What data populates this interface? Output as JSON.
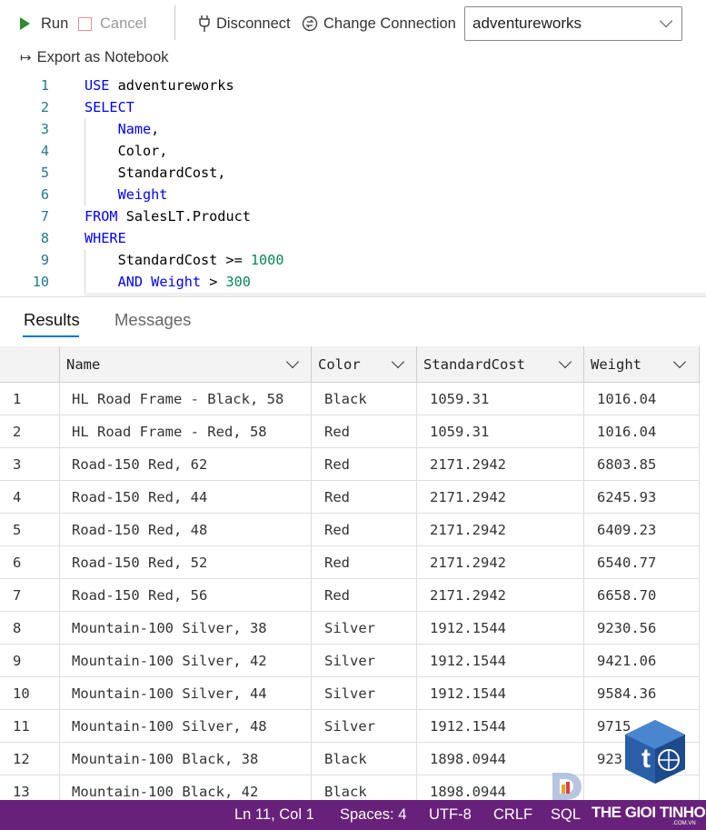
{
  "toolbar": {
    "run_label": "Run",
    "cancel_label": "Cancel",
    "disconnect_label": "Disconnect",
    "change_connection_label": "Change Connection",
    "database": "adventureworks",
    "export_label": "Export as Notebook"
  },
  "editor": {
    "lines": [
      {
        "n": "1",
        "indent": "",
        "parts": [
          {
            "t": "USE",
            "c": "kw"
          },
          {
            "t": " adventureworks",
            "c": "plain"
          }
        ]
      },
      {
        "n": "2",
        "indent": "",
        "parts": [
          {
            "t": "SELECT",
            "c": "kw"
          }
        ]
      },
      {
        "n": "3",
        "indent": "    ",
        "parts": [
          {
            "t": "Name",
            "c": "kw"
          },
          {
            "t": ",",
            "c": "plain"
          }
        ]
      },
      {
        "n": "4",
        "indent": "    ",
        "parts": [
          {
            "t": "Color,",
            "c": "plain"
          }
        ]
      },
      {
        "n": "5",
        "indent": "    ",
        "parts": [
          {
            "t": "StandardCost,",
            "c": "plain"
          }
        ]
      },
      {
        "n": "6",
        "indent": "    ",
        "parts": [
          {
            "t": "Weight",
            "c": "kw"
          }
        ]
      },
      {
        "n": "7",
        "indent": "",
        "parts": [
          {
            "t": "FROM",
            "c": "kw"
          },
          {
            "t": " SalesLT.Product",
            "c": "plain"
          }
        ]
      },
      {
        "n": "8",
        "indent": "",
        "parts": [
          {
            "t": "WHERE",
            "c": "kw"
          }
        ]
      },
      {
        "n": "9",
        "indent": "    ",
        "parts": [
          {
            "t": "StandardCost >= ",
            "c": "plain"
          },
          {
            "t": "1000",
            "c": "num"
          }
        ]
      },
      {
        "n": "10",
        "indent": "    ",
        "parts": [
          {
            "t": "AND",
            "c": "kw"
          },
          {
            "t": " ",
            "c": "plain"
          },
          {
            "t": "Weight",
            "c": "kw"
          },
          {
            "t": " > ",
            "c": "plain"
          },
          {
            "t": "300",
            "c": "num"
          }
        ]
      }
    ]
  },
  "results": {
    "tab_results": "Results",
    "tab_messages": "Messages",
    "columns": [
      "Name",
      "Color",
      "StandardCost",
      "Weight"
    ],
    "rows": [
      [
        "1",
        "HL Road Frame - Black, 58",
        "Black",
        "1059.31",
        "1016.04"
      ],
      [
        "2",
        "HL Road Frame - Red, 58",
        "Red",
        "1059.31",
        "1016.04"
      ],
      [
        "3",
        "Road-150 Red, 62",
        "Red",
        "2171.2942",
        "6803.85"
      ],
      [
        "4",
        "Road-150 Red, 44",
        "Red",
        "2171.2942",
        "6245.93"
      ],
      [
        "5",
        "Road-150 Red, 48",
        "Red",
        "2171.2942",
        "6409.23"
      ],
      [
        "6",
        "Road-150 Red, 52",
        "Red",
        "2171.2942",
        "6540.77"
      ],
      [
        "7",
        "Road-150 Red, 56",
        "Red",
        "2171.2942",
        "6658.70"
      ],
      [
        "8",
        "Mountain-100 Silver, 38",
        "Silver",
        "1912.1544",
        "9230.56"
      ],
      [
        "9",
        "Mountain-100 Silver, 42",
        "Silver",
        "1912.1544",
        "9421.06"
      ],
      [
        "10",
        "Mountain-100 Silver, 44",
        "Silver",
        "1912.1544",
        "9584.36"
      ],
      [
        "11",
        "Mountain-100 Silver, 48",
        "Silver",
        "1912.1544",
        "9715"
      ],
      [
        "12",
        "Mountain-100 Black, 38",
        "Black",
        "1898.0944",
        "923"
      ],
      [
        "13",
        "Mountain-100 Black, 42",
        "Black",
        "1898.0944",
        ""
      ]
    ]
  },
  "status_bar": {
    "position": "Ln 11, Col 1",
    "spaces": "Spaces: 4",
    "encoding": "UTF-8",
    "eol": "CRLF",
    "language": "SQL",
    "color": "#68217a"
  },
  "watermark": {
    "brand": "THE GIOI TINHOC",
    "sub": ".COM.VN"
  }
}
